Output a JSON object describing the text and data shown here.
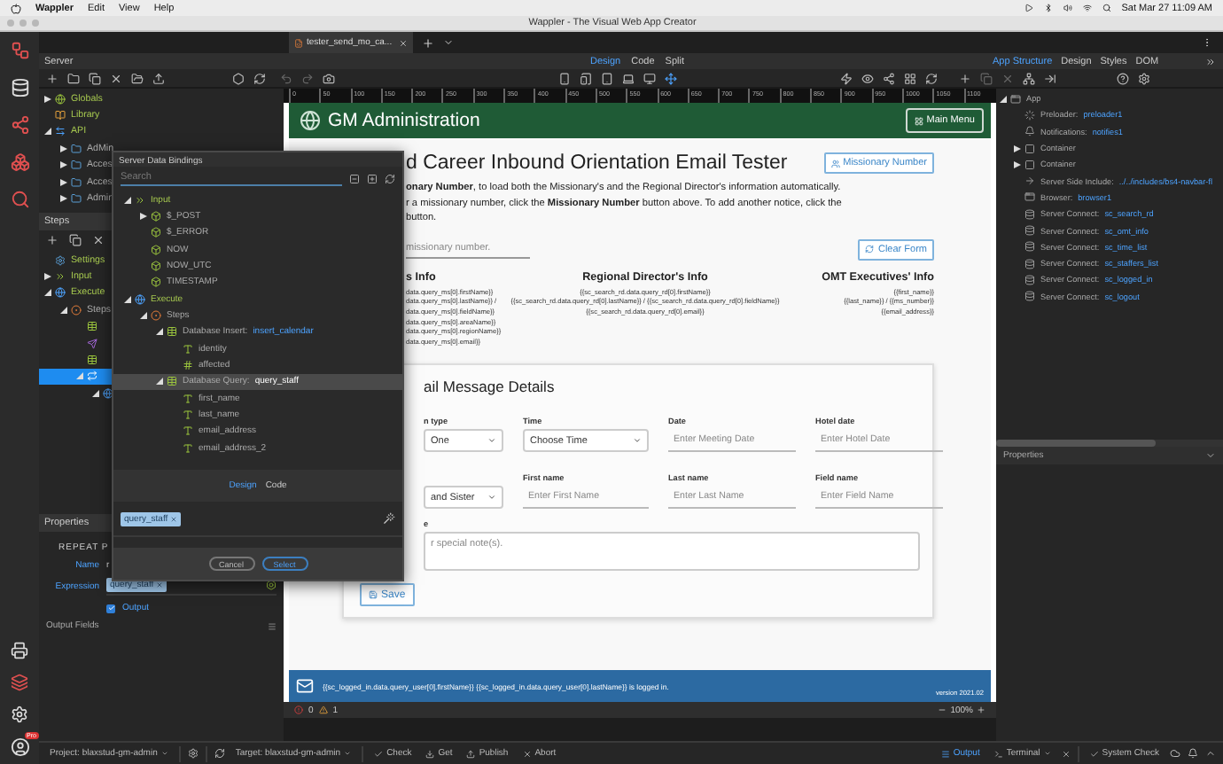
{
  "menubar": {
    "app": "Wappler",
    "menus": [
      "Edit",
      "View",
      "Help"
    ],
    "clock": "Sat Mar 27  11:09 AM"
  },
  "window": {
    "title": "Wappler - The Visual Web App Creator"
  },
  "rail": {
    "badge": "Pro"
  },
  "doc_tabs": [
    {
      "label": "tester_send_mo_ca...",
      "selected": true
    }
  ],
  "server_bar": {
    "label": "Server",
    "view_tabs": [
      {
        "label": "Design",
        "selected": true
      },
      {
        "label": "Code",
        "selected": false
      },
      {
        "label": "Split",
        "selected": false
      }
    ],
    "panel_tabs": [
      {
        "label": "App Structure",
        "selected": true
      },
      {
        "label": "Design",
        "selected": false
      },
      {
        "label": "Styles",
        "selected": false
      },
      {
        "label": "DOM",
        "selected": false
      }
    ]
  },
  "server_tree": [
    {
      "kind": "globe",
      "label": "Globals",
      "expanded": false
    },
    {
      "kind": "book",
      "label": "Library"
    },
    {
      "kind": "api",
      "label": "API",
      "expanded": true,
      "children": [
        {
          "kind": "folder",
          "label": "AdMin",
          "expanded": false
        },
        {
          "kind": "folder",
          "label": "Acces",
          "expanded": false
        },
        {
          "kind": "folder",
          "label": "Acces",
          "expanded": false
        },
        {
          "kind": "folder",
          "label": "Admin",
          "expanded": false
        }
      ]
    }
  ],
  "steps_panel": {
    "title": "Steps",
    "items": [
      {
        "kind": "gear",
        "label": "Settings",
        "selected": false
      },
      {
        "kind": "input",
        "label": "Input",
        "expanded": false,
        "selected": false
      },
      {
        "kind": "execute",
        "label": "Execute",
        "expanded": true,
        "selected": false,
        "children": [
          {
            "kind": "steps",
            "label": "Steps",
            "expanded": true,
            "selected": false,
            "children": [
              {
                "kind": "table",
                "selected": false
              },
              {
                "kind": "send",
                "selected": false
              },
              {
                "kind": "table",
                "selected": false
              },
              {
                "kind": "repeat",
                "expanded": true,
                "selected": true,
                "children": [
                  {
                    "kind": "execute",
                    "expanded": true,
                    "selected": false
                  }
                ]
              }
            ]
          }
        ]
      }
    ]
  },
  "properties_panel": {
    "title": "Properties",
    "section": "REPEAT P",
    "name_label": "Name",
    "name_value": "r",
    "expression_label": "Expression",
    "expression_token": "query_staff",
    "output": {
      "label": "Output",
      "checked": true
    },
    "output_fields_label": "Output Fields"
  },
  "dialog": {
    "title": "Server Data Bindings",
    "search_placeholder": "Search",
    "tree": [
      {
        "kind": "input",
        "label": "Input",
        "expanded": true,
        "selected": false,
        "children": [
          {
            "kind": "box",
            "label": "$_POST",
            "expanded": false,
            "selected": false
          },
          {
            "kind": "box",
            "label": "$_ERROR",
            "selected": false
          },
          {
            "kind": "box",
            "label": "NOW",
            "selected": false
          },
          {
            "kind": "box",
            "label": "NOW_UTC",
            "selected": false
          },
          {
            "kind": "box",
            "label": "TIMESTAMP",
            "selected": false
          }
        ]
      },
      {
        "kind": "execute",
        "label": "Execute",
        "expanded": true,
        "selected": false,
        "children": [
          {
            "kind": "steps",
            "label": "Steps",
            "expanded": true,
            "selected": false,
            "children": [
              {
                "kind": "table",
                "label": "Database Insert:",
                "name": "insert_calendar",
                "expanded": true,
                "selected": false,
                "children": [
                  {
                    "kind": "text",
                    "label": "identity",
                    "selected": false
                  },
                  {
                    "kind": "number",
                    "label": "affected",
                    "selected": false
                  }
                ]
              },
              {
                "kind": "table",
                "label": "Database Query:",
                "name": "query_staff",
                "expanded": true,
                "selected": true,
                "children": [
                  {
                    "kind": "text",
                    "label": "first_name",
                    "selected": false
                  },
                  {
                    "kind": "text",
                    "label": "last_name",
                    "selected": false
                  },
                  {
                    "kind": "text",
                    "label": "email_address",
                    "selected": false
                  },
                  {
                    "kind": "text",
                    "label": "email_address_2",
                    "selected": false
                  }
                ]
              }
            ]
          }
        ]
      }
    ],
    "tabs": [
      {
        "label": "Design",
        "selected": true
      },
      {
        "label": "Code",
        "selected": false
      }
    ],
    "token": "query_staff",
    "buttons": [
      {
        "label": "Cancel",
        "kind": "secondary"
      },
      {
        "label": "Select",
        "kind": "primary"
      }
    ]
  },
  "canvas": {
    "ruler": [
      "0",
      "50",
      "100",
      "150",
      "200",
      "250",
      "300",
      "350",
      "400",
      "450",
      "500",
      "550",
      "600",
      "650",
      "700",
      "750",
      "800",
      "850",
      "900",
      "950",
      "1000",
      "1050",
      "1100"
    ],
    "header": {
      "title": "GM Administration",
      "button": "Main Menu"
    },
    "heading": "d Career Inbound Orientation Email Tester",
    "lookup_button": "Missionary Number",
    "intro": [
      "**onary Number**, to load both the Missionary's and the Regional Director's information automatically.",
      "r a missionary number, click the **Missionary Number** button above. To add another notice, click the",
      "button."
    ],
    "search_placeholder": "missionary number.",
    "clear_button": "Clear Form",
    "info_columns": [
      {
        "title": "s Info",
        "lines": [
          "data.query_ms[0].firstName}}",
          "data.query_ms[0].lastName}} /",
          "data.query_ms[0].fieldName}}",
          "data.query_ms[0].areaName}}",
          "data.query_ms[0].regionName}}",
          "data.query_ms[0].email}}"
        ]
      },
      {
        "title": "Regional Director's Info",
        "lines": [
          "{{sc_search_rd.data.query_rd[0].firstName}}",
          "{{sc_search_rd.data.query_rd[0].lastName}} / {{sc_search_rd.data.query_rd[0].fieldName}}",
          "{{sc_search_rd.data.query_rd[0].email}}"
        ]
      },
      {
        "title": "OMT Executives' Info",
        "lines": [
          "{{first_name}}",
          "{{last_name}} / {{ms_number}}",
          "{{email_address}}"
        ]
      }
    ],
    "card": {
      "title": "ail Message Details",
      "fields": [
        {
          "kind": "select",
          "label": "n type",
          "value": "One"
        },
        {
          "kind": "select",
          "label": "Time",
          "value": "Choose Time"
        },
        {
          "kind": "input",
          "label": "Date",
          "placeholder": "Enter Meeting Date"
        },
        {
          "kind": "input",
          "label": "Hotel date",
          "placeholder": "Enter Hotel Date"
        },
        {
          "kind": "select",
          "value": "and Sister"
        },
        {
          "kind": "input",
          "label": "First name",
          "placeholder": "Enter First Name"
        },
        {
          "kind": "input",
          "label": "Last name",
          "placeholder": "Enter Last Name"
        },
        {
          "kind": "input",
          "label": "Field name",
          "placeholder": "Enter Field Name"
        }
      ],
      "notes_label": "e",
      "notes_placeholder": "r special note(s).",
      "save": "Save"
    },
    "footer": {
      "text": "{{sc_logged_in.data.query_user[0].firstName}} {{sc_logged_in.data.query_user[0].lastName}} is logged in.",
      "version": "version 2021.02"
    },
    "status": {
      "errors": "0",
      "warnings": "1",
      "zoom": "100%"
    }
  },
  "right_panel": {
    "tree": [
      {
        "kind": "app",
        "label": "App",
        "expanded": true,
        "children": [
          {
            "kind": "preloader",
            "label": "Preloader:",
            "name": "preloader1"
          },
          {
            "kind": "bell",
            "label": "Notifications:",
            "name": "notifies1"
          },
          {
            "kind": "container",
            "label": "Container",
            "expanded": false
          },
          {
            "kind": "container",
            "label": "Container",
            "expanded": false
          },
          {
            "kind": "include",
            "label": "Server Side Include:",
            "name": "../../includes/bs4-navbar-fl"
          },
          {
            "kind": "browser",
            "label": "Browser:",
            "name": "browser1"
          },
          {
            "kind": "server",
            "label": "Server Connect:",
            "name": "sc_search_rd"
          },
          {
            "kind": "server",
            "label": "Server Connect:",
            "name": "sc_omt_info"
          },
          {
            "kind": "server",
            "label": "Server Connect:",
            "name": "sc_time_list"
          },
          {
            "kind": "server",
            "label": "Server Connect:",
            "name": "sc_staffers_list"
          },
          {
            "kind": "server",
            "label": "Server Connect:",
            "name": "sc_logged_in"
          },
          {
            "kind": "server",
            "label": "Server Connect:",
            "name": "sc_logout"
          }
        ]
      }
    ],
    "properties_title": "Properties"
  },
  "bottom_bar": {
    "project": "Project: blaxstud-gm-admin",
    "target": "Target: blaxstud-gm-admin",
    "actions": [
      {
        "kind": "check",
        "label": "Check"
      },
      {
        "kind": "get",
        "label": "Get"
      },
      {
        "kind": "publish",
        "label": "Publish"
      },
      {
        "kind": "abort",
        "label": "Abort"
      }
    ],
    "output": "Output",
    "terminal": "Terminal",
    "system_check": "System Check"
  }
}
